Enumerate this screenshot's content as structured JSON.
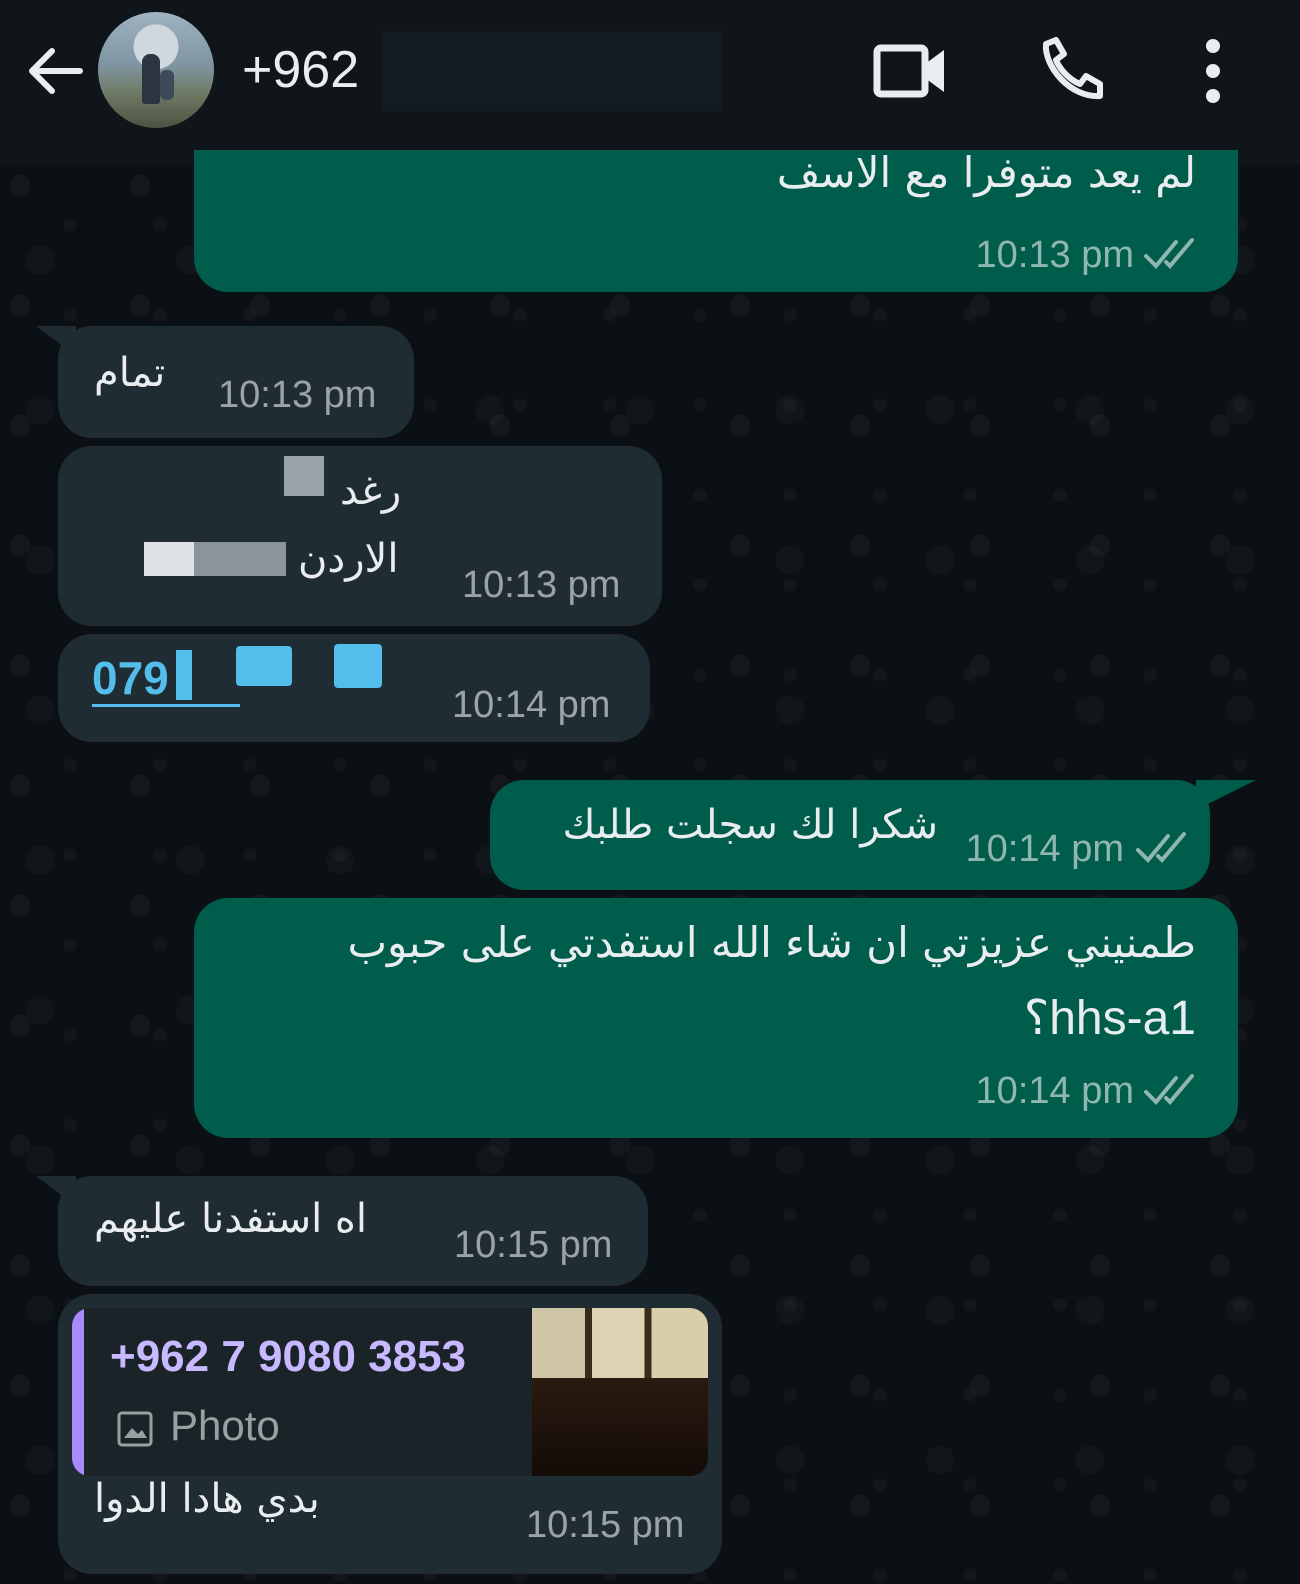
{
  "header": {
    "contact_name": "+962",
    "back_icon": "arrow-left-icon",
    "video_icon": "video-camera-icon",
    "call_icon": "phone-icon",
    "menu_icon": "more-vertical-icon"
  },
  "colors": {
    "header_bg": "#0f1518",
    "chat_bg": "#0b1014",
    "outgoing_bubble": "#005c4b",
    "incoming_bubble": "#202c33",
    "link": "#53bdeb",
    "quote_accent": "#a78bfa"
  },
  "messages": [
    {
      "direction": "outgoing",
      "text": "لم يعد متوفرا مع الاسف",
      "time": "10:13 pm",
      "status": "read"
    },
    {
      "direction": "incoming",
      "text": "تمام",
      "time": "10:13 pm"
    },
    {
      "direction": "incoming",
      "line1": "رغد",
      "line2": "الاردن",
      "time": "10:13 pm"
    },
    {
      "direction": "incoming",
      "phone": "079",
      "time": "10:14 pm"
    },
    {
      "direction": "outgoing",
      "text": "شكرا لك سجلت طلبك",
      "time": "10:14 pm",
      "status": "read"
    },
    {
      "direction": "outgoing",
      "line1": "طمنيني عزيزتي ان شاء الله استفدتي على حبوب",
      "line2": "hhs-a1؟",
      "time": "10:14 pm",
      "status": "read"
    },
    {
      "direction": "incoming",
      "text": "اه استفدنا عليهم",
      "time": "10:15 pm"
    },
    {
      "direction": "incoming",
      "quoted_author": "+962 7 9080 3853",
      "quoted_type": "Photo",
      "quoted_type_icon": "image-icon",
      "text": "بدي هادا الدوا",
      "time": "10:15 pm"
    }
  ]
}
